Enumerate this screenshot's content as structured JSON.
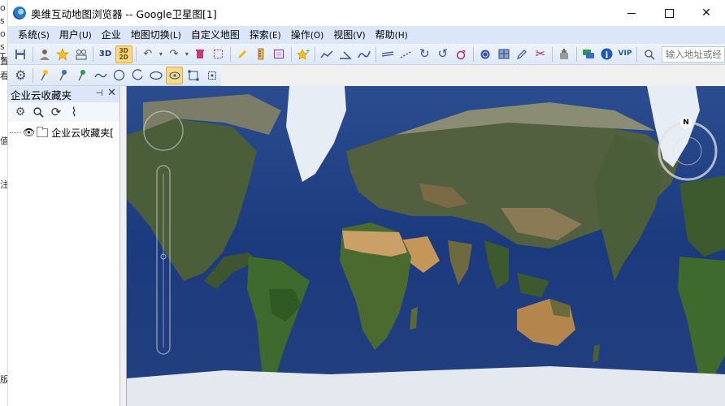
{
  "window": {
    "title": "奥维互动地图浏览器 -- Google卫星图[1]",
    "controls": {
      "minimize": "",
      "maximize": "",
      "close": "✕"
    }
  },
  "menu": [
    {
      "label": "系统",
      "accel": "(S)"
    },
    {
      "label": "用户",
      "accel": "(U)"
    },
    {
      "label": "企业",
      "accel": ""
    },
    {
      "label": "地图切换",
      "accel": "(L)"
    },
    {
      "label": "自定义地图",
      "accel": ""
    },
    {
      "label": "探索",
      "accel": "(E)"
    },
    {
      "label": "操作",
      "accel": "(O)"
    },
    {
      "label": "视图",
      "accel": "(V)"
    },
    {
      "label": "帮助",
      "accel": "(H)"
    }
  ],
  "toolbar": {
    "btn_3d": "3D",
    "btn_3d2d": "3D 2D",
    "btn_vip": "VIP",
    "address_placeholder": "输入地址或经"
  },
  "panel": {
    "title": "企业云收藏夹",
    "pin": "⊣",
    "close": "✕",
    "tree_item": "企业云收藏夹["
  },
  "map": {
    "source": "Google卫星图",
    "compass_label": "N"
  },
  "background_window": {
    "chars": [
      "o",
      "s",
      "o",
      "s",
      "T",
      "置",
      "看",
      "值",
      "注",
      "版"
    ]
  },
  "colors": {
    "menu_bg": "#dbe7f8",
    "ocean": "#1f3f86",
    "land_green": "#3d5a2e",
    "desert": "#c89a5a",
    "ice": "#e8eef5"
  }
}
